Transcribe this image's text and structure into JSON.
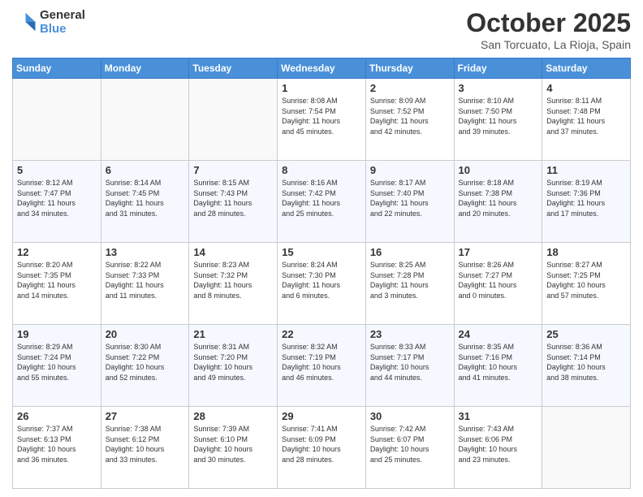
{
  "header": {
    "logo_general": "General",
    "logo_blue": "Blue",
    "month_title": "October 2025",
    "location": "San Torcuato, La Rioja, Spain"
  },
  "weekdays": [
    "Sunday",
    "Monday",
    "Tuesday",
    "Wednesday",
    "Thursday",
    "Friday",
    "Saturday"
  ],
  "weeks": [
    [
      {
        "day": "",
        "info": ""
      },
      {
        "day": "",
        "info": ""
      },
      {
        "day": "",
        "info": ""
      },
      {
        "day": "1",
        "info": "Sunrise: 8:08 AM\nSunset: 7:54 PM\nDaylight: 11 hours\nand 45 minutes."
      },
      {
        "day": "2",
        "info": "Sunrise: 8:09 AM\nSunset: 7:52 PM\nDaylight: 11 hours\nand 42 minutes."
      },
      {
        "day": "3",
        "info": "Sunrise: 8:10 AM\nSunset: 7:50 PM\nDaylight: 11 hours\nand 39 minutes."
      },
      {
        "day": "4",
        "info": "Sunrise: 8:11 AM\nSunset: 7:48 PM\nDaylight: 11 hours\nand 37 minutes."
      }
    ],
    [
      {
        "day": "5",
        "info": "Sunrise: 8:12 AM\nSunset: 7:47 PM\nDaylight: 11 hours\nand 34 minutes."
      },
      {
        "day": "6",
        "info": "Sunrise: 8:14 AM\nSunset: 7:45 PM\nDaylight: 11 hours\nand 31 minutes."
      },
      {
        "day": "7",
        "info": "Sunrise: 8:15 AM\nSunset: 7:43 PM\nDaylight: 11 hours\nand 28 minutes."
      },
      {
        "day": "8",
        "info": "Sunrise: 8:16 AM\nSunset: 7:42 PM\nDaylight: 11 hours\nand 25 minutes."
      },
      {
        "day": "9",
        "info": "Sunrise: 8:17 AM\nSunset: 7:40 PM\nDaylight: 11 hours\nand 22 minutes."
      },
      {
        "day": "10",
        "info": "Sunrise: 8:18 AM\nSunset: 7:38 PM\nDaylight: 11 hours\nand 20 minutes."
      },
      {
        "day": "11",
        "info": "Sunrise: 8:19 AM\nSunset: 7:36 PM\nDaylight: 11 hours\nand 17 minutes."
      }
    ],
    [
      {
        "day": "12",
        "info": "Sunrise: 8:20 AM\nSunset: 7:35 PM\nDaylight: 11 hours\nand 14 minutes."
      },
      {
        "day": "13",
        "info": "Sunrise: 8:22 AM\nSunset: 7:33 PM\nDaylight: 11 hours\nand 11 minutes."
      },
      {
        "day": "14",
        "info": "Sunrise: 8:23 AM\nSunset: 7:32 PM\nDaylight: 11 hours\nand 8 minutes."
      },
      {
        "day": "15",
        "info": "Sunrise: 8:24 AM\nSunset: 7:30 PM\nDaylight: 11 hours\nand 6 minutes."
      },
      {
        "day": "16",
        "info": "Sunrise: 8:25 AM\nSunset: 7:28 PM\nDaylight: 11 hours\nand 3 minutes."
      },
      {
        "day": "17",
        "info": "Sunrise: 8:26 AM\nSunset: 7:27 PM\nDaylight: 11 hours\nand 0 minutes."
      },
      {
        "day": "18",
        "info": "Sunrise: 8:27 AM\nSunset: 7:25 PM\nDaylight: 10 hours\nand 57 minutes."
      }
    ],
    [
      {
        "day": "19",
        "info": "Sunrise: 8:29 AM\nSunset: 7:24 PM\nDaylight: 10 hours\nand 55 minutes."
      },
      {
        "day": "20",
        "info": "Sunrise: 8:30 AM\nSunset: 7:22 PM\nDaylight: 10 hours\nand 52 minutes."
      },
      {
        "day": "21",
        "info": "Sunrise: 8:31 AM\nSunset: 7:20 PM\nDaylight: 10 hours\nand 49 minutes."
      },
      {
        "day": "22",
        "info": "Sunrise: 8:32 AM\nSunset: 7:19 PM\nDaylight: 10 hours\nand 46 minutes."
      },
      {
        "day": "23",
        "info": "Sunrise: 8:33 AM\nSunset: 7:17 PM\nDaylight: 10 hours\nand 44 minutes."
      },
      {
        "day": "24",
        "info": "Sunrise: 8:35 AM\nSunset: 7:16 PM\nDaylight: 10 hours\nand 41 minutes."
      },
      {
        "day": "25",
        "info": "Sunrise: 8:36 AM\nSunset: 7:14 PM\nDaylight: 10 hours\nand 38 minutes."
      }
    ],
    [
      {
        "day": "26",
        "info": "Sunrise: 7:37 AM\nSunset: 6:13 PM\nDaylight: 10 hours\nand 36 minutes."
      },
      {
        "day": "27",
        "info": "Sunrise: 7:38 AM\nSunset: 6:12 PM\nDaylight: 10 hours\nand 33 minutes."
      },
      {
        "day": "28",
        "info": "Sunrise: 7:39 AM\nSunset: 6:10 PM\nDaylight: 10 hours\nand 30 minutes."
      },
      {
        "day": "29",
        "info": "Sunrise: 7:41 AM\nSunset: 6:09 PM\nDaylight: 10 hours\nand 28 minutes."
      },
      {
        "day": "30",
        "info": "Sunrise: 7:42 AM\nSunset: 6:07 PM\nDaylight: 10 hours\nand 25 minutes."
      },
      {
        "day": "31",
        "info": "Sunrise: 7:43 AM\nSunset: 6:06 PM\nDaylight: 10 hours\nand 23 minutes."
      },
      {
        "day": "",
        "info": ""
      }
    ]
  ]
}
